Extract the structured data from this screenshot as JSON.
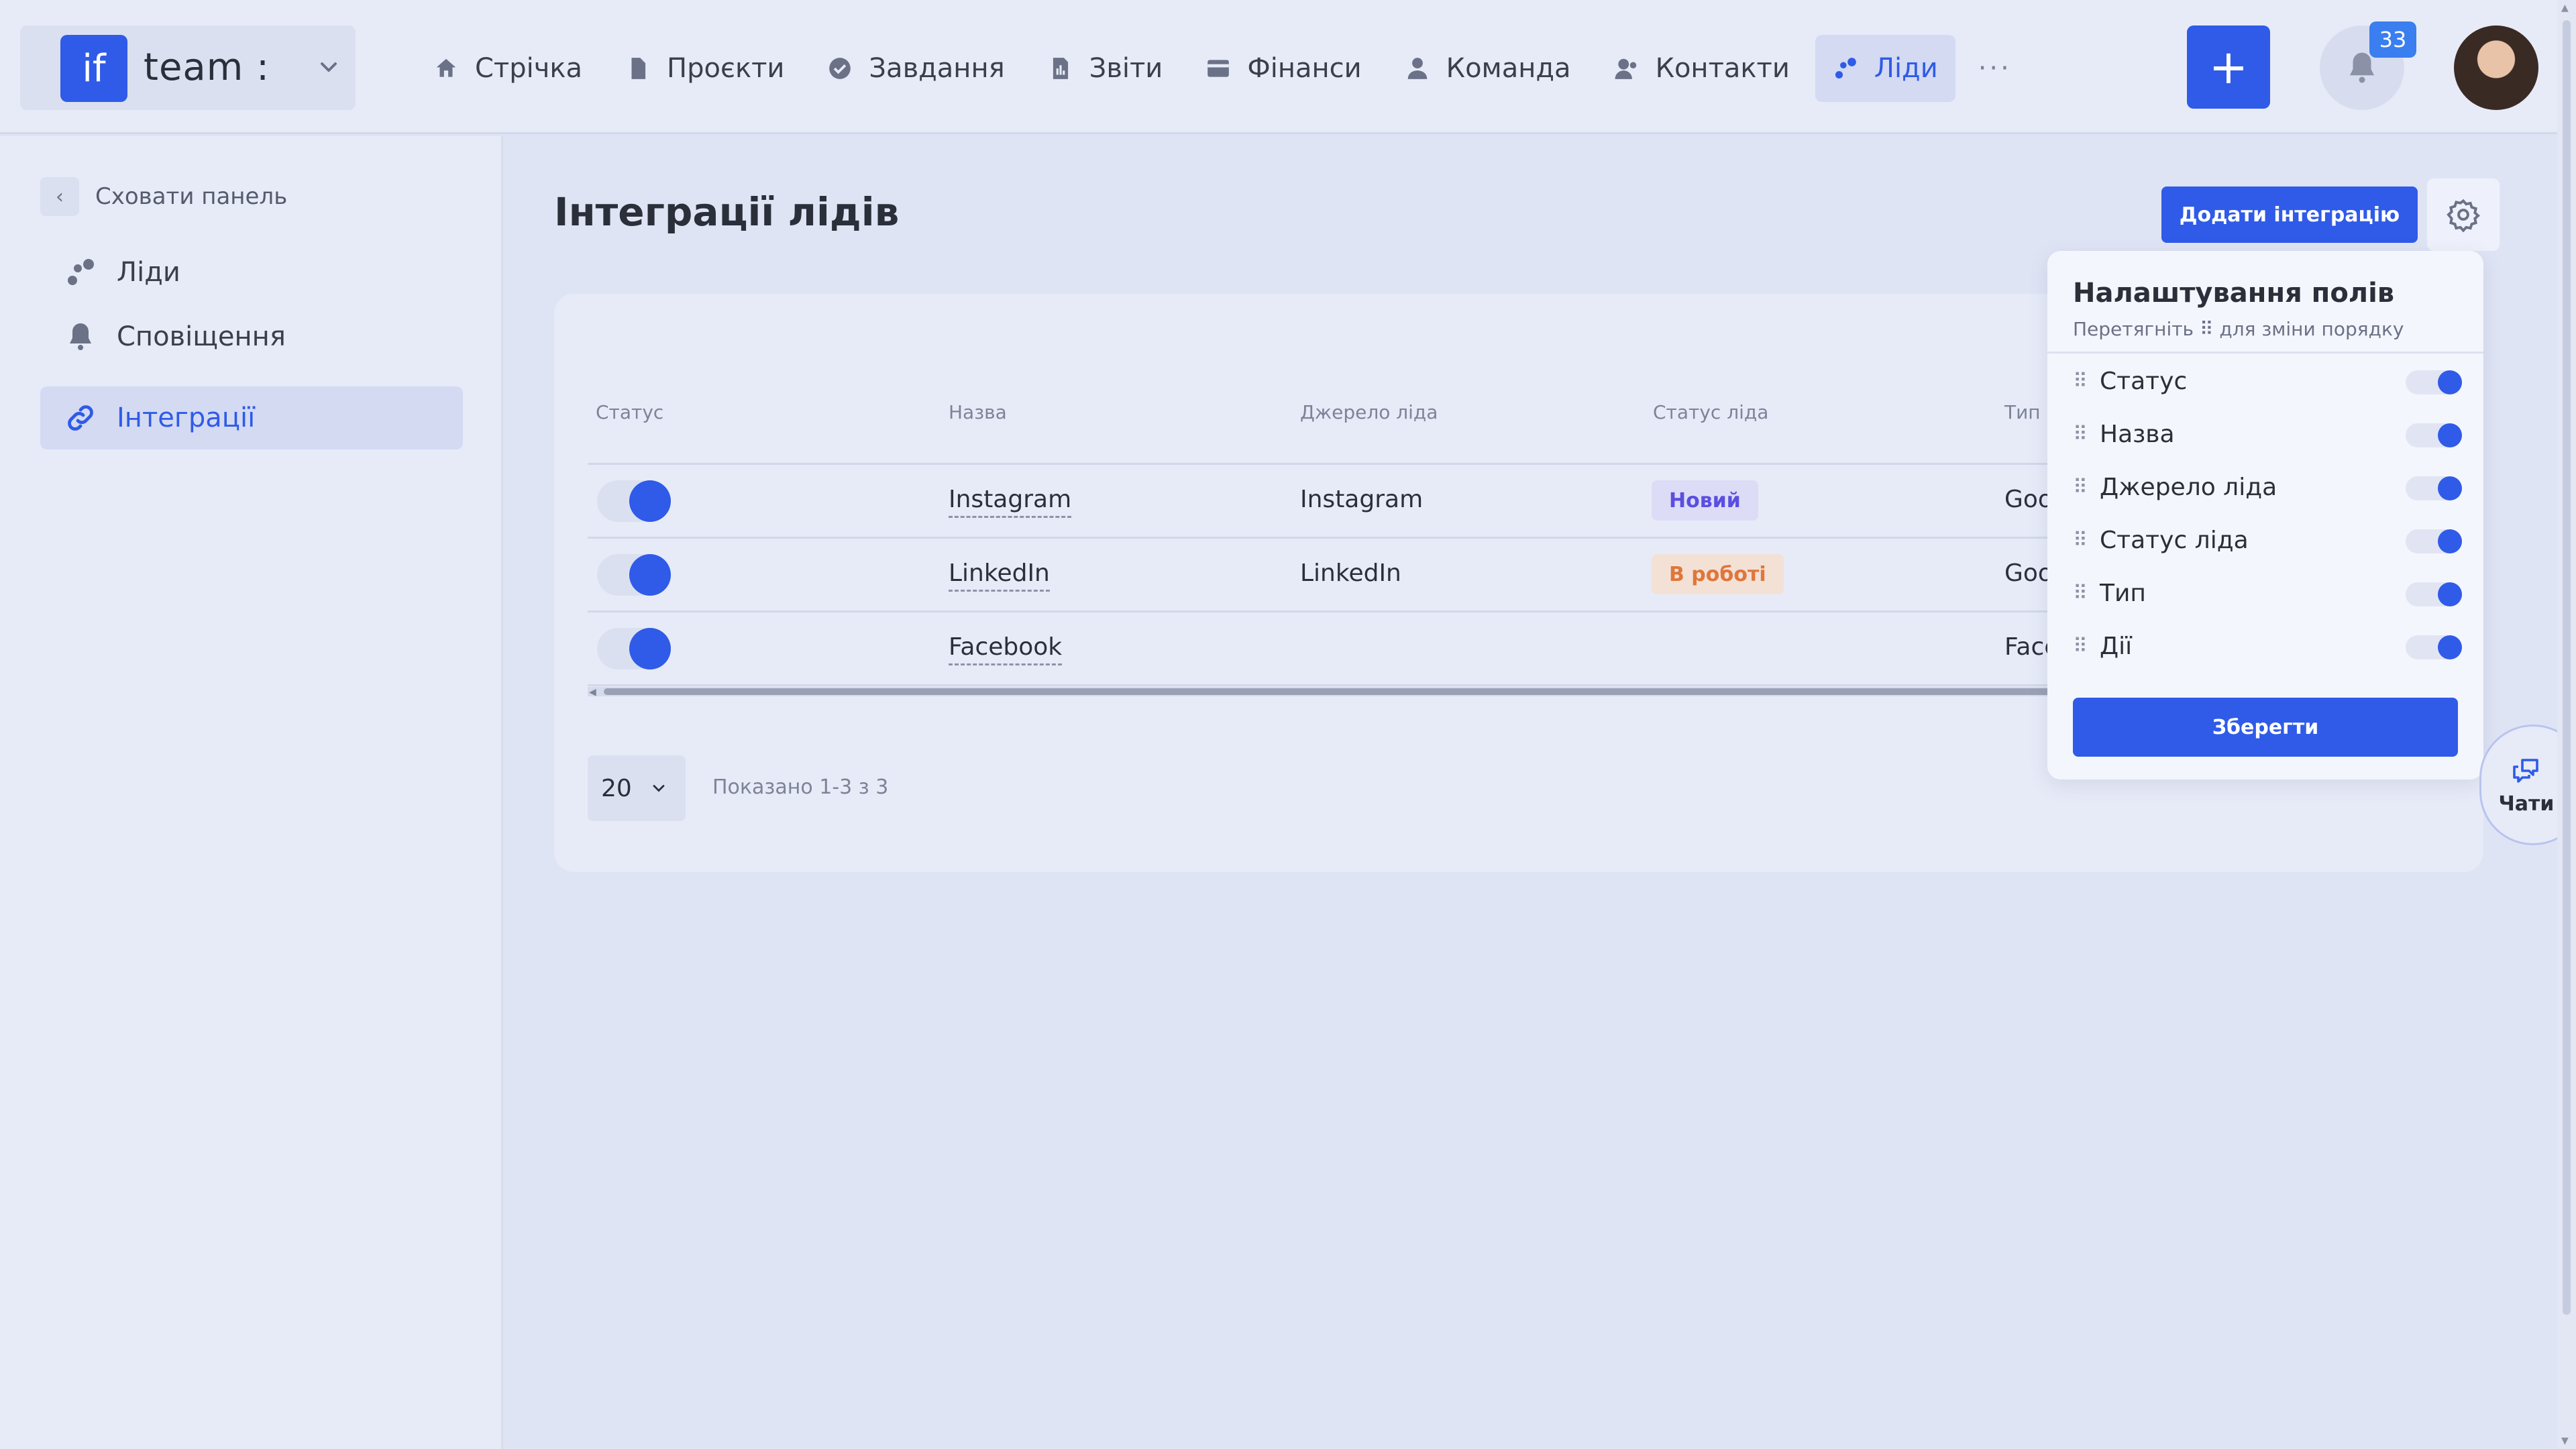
{
  "header": {
    "logo_text": "if",
    "team_name": "team :",
    "nav": [
      {
        "label": "Стрічка",
        "icon": "home-icon"
      },
      {
        "label": "Проєкти",
        "icon": "document-icon"
      },
      {
        "label": "Завдання",
        "icon": "check-circle-icon"
      },
      {
        "label": "Звіти",
        "icon": "report-icon"
      },
      {
        "label": "Фінанси",
        "icon": "wallet-icon"
      },
      {
        "label": "Команда",
        "icon": "user-icon"
      },
      {
        "label": "Контакти",
        "icon": "contacts-icon"
      },
      {
        "label": "Ліди",
        "icon": "leads-icon",
        "active": true
      }
    ],
    "more_label": "···",
    "add_label": "+",
    "notifications_count": "33"
  },
  "sidebar": {
    "hide_panel_label": "Сховати панель",
    "items": [
      {
        "label": "Ліди",
        "icon": "leads-icon"
      },
      {
        "label": "Сповіщення",
        "icon": "bell-icon"
      },
      {
        "label": "Інтеграції",
        "icon": "link-icon",
        "active": true
      }
    ]
  },
  "main": {
    "title": "Інтеграції лідів",
    "add_integration_label": "Додати інтеграцію",
    "table": {
      "columns": [
        "Статус",
        "Назва",
        "Джерело ліда",
        "Статус ліда",
        "Тип"
      ],
      "rows": [
        {
          "enabled": true,
          "name": "Instagram",
          "source": "Instagram",
          "lead_status": "Новий",
          "type": "Goo"
        },
        {
          "enabled": true,
          "name": "LinkedIn",
          "source": "LinkedIn",
          "lead_status": "В роботі",
          "type": "Goo"
        },
        {
          "enabled": true,
          "name": "Facebook",
          "source": "",
          "lead_status": "",
          "type": "Face"
        }
      ]
    },
    "pagination": {
      "per_page": "20",
      "shown_text": "Показано 1-3 з 3"
    }
  },
  "field_settings": {
    "title": "Налаштування полів",
    "subtitle": "Перетягніть ⠿ для зміни порядку",
    "fields": [
      {
        "label": "Статус",
        "enabled": true
      },
      {
        "label": "Назва",
        "enabled": true
      },
      {
        "label": "Джерело ліда",
        "enabled": true
      },
      {
        "label": "Статус ліда",
        "enabled": true
      },
      {
        "label": "Тип",
        "enabled": true
      },
      {
        "label": "Дії",
        "enabled": true
      }
    ],
    "save_label": "Зберегти"
  },
  "chats": {
    "label": "Чати"
  },
  "colors": {
    "accent": "#2f5be8",
    "badge_new_text": "#5b4ee0",
    "badge_work_text": "#e0763a",
    "background": "#dfe4f5"
  }
}
